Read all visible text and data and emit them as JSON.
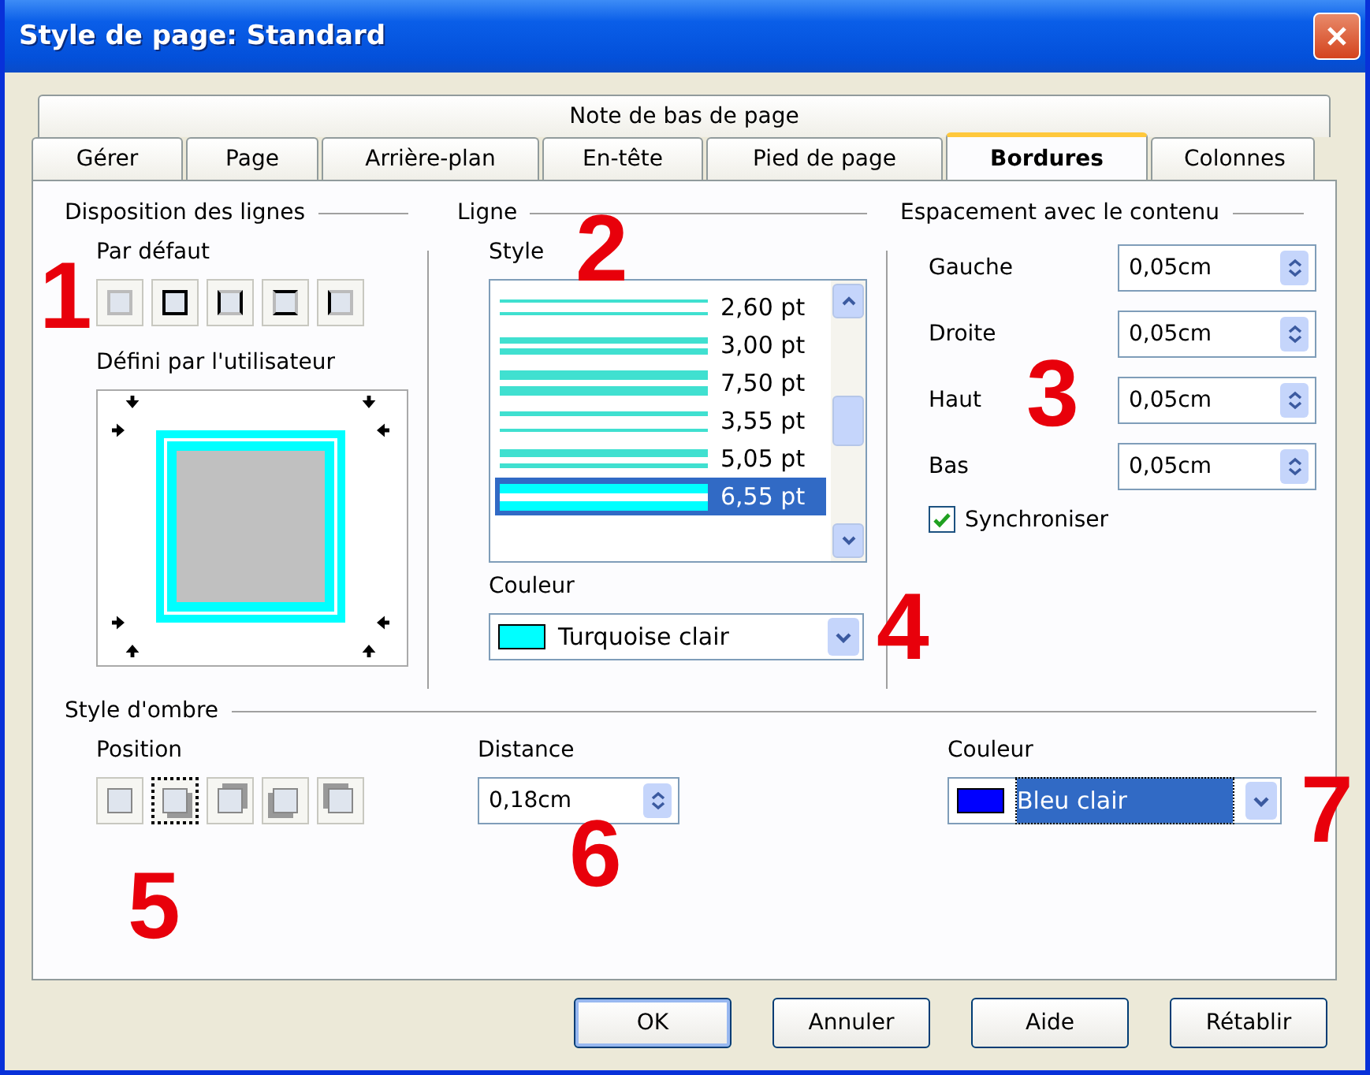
{
  "window": {
    "title": "Style de page: Standard"
  },
  "tabs_top": [
    {
      "label": "Note de bas de page",
      "selected": false
    }
  ],
  "tabs": [
    {
      "label": "Gérer",
      "selected": false
    },
    {
      "label": "Page",
      "selected": false
    },
    {
      "label": "Arrière-plan",
      "selected": false
    },
    {
      "label": "En-tête",
      "selected": false
    },
    {
      "label": "Pied de page",
      "selected": false
    },
    {
      "label": "Bordures",
      "selected": true
    },
    {
      "label": "Colonnes",
      "selected": false
    }
  ],
  "line_arrangement": {
    "title": "Disposition des lignes",
    "default_label": "Par défaut",
    "presets": [
      {
        "kind": "none",
        "selected": false
      },
      {
        "kind": "all",
        "selected": false
      },
      {
        "kind": "left-right",
        "selected": false
      },
      {
        "kind": "top-bottom",
        "selected": false
      },
      {
        "kind": "left",
        "selected": false
      }
    ],
    "user_label": "Défini par l'utilisateur"
  },
  "line": {
    "title": "Ligne",
    "style_label": "Style",
    "styles": [
      {
        "kind": "thin-thin",
        "label": "2,60 pt",
        "selected": false
      },
      {
        "kind": "medium-medium",
        "label": "3,00 pt",
        "selected": false
      },
      {
        "kind": "thick-thick",
        "label": "7,50 pt",
        "selected": false
      },
      {
        "kind": "thin-thin-wide",
        "label": "3,55 pt",
        "selected": false
      },
      {
        "kind": "medium-thin",
        "label": "5,05 pt",
        "selected": false
      },
      {
        "kind": "thick-thin",
        "label": "6,55 pt",
        "selected": true
      }
    ],
    "color_label": "Couleur",
    "color": {
      "name": "Turquoise clair",
      "color": "#00ffff"
    }
  },
  "spacing": {
    "title": "Espacement avec le contenu",
    "fields": [
      {
        "label": "Gauche",
        "value": "0,05cm"
      },
      {
        "label": "Droite",
        "value": "0,05cm"
      },
      {
        "label": "Haut",
        "value": "0,05cm"
      },
      {
        "label": "Bas",
        "value": "0,05cm"
      }
    ],
    "sync": {
      "label": "Synchroniser",
      "checked": true
    }
  },
  "shadow": {
    "title": "Style d'ombre",
    "position_label": "Position",
    "positions": [
      {
        "kind": "none",
        "selected": false
      },
      {
        "kind": "bottom-right",
        "selected": true
      },
      {
        "kind": "top-right",
        "selected": false
      },
      {
        "kind": "bottom-left",
        "selected": false
      },
      {
        "kind": "top-left",
        "selected": false
      }
    ],
    "distance_label": "Distance",
    "distance": "0,18cm",
    "color_label": "Couleur",
    "color": {
      "name": "Bleu clair",
      "color": "#0000ff"
    }
  },
  "buttons": [
    {
      "label": "OK",
      "default": true
    },
    {
      "label": "Annuler",
      "default": false
    },
    {
      "label": "Aide",
      "default": false
    },
    {
      "label": "Rétablir",
      "default": false
    }
  ],
  "annotations": [
    "1",
    "2",
    "3",
    "4",
    "5",
    "6",
    "7"
  ]
}
